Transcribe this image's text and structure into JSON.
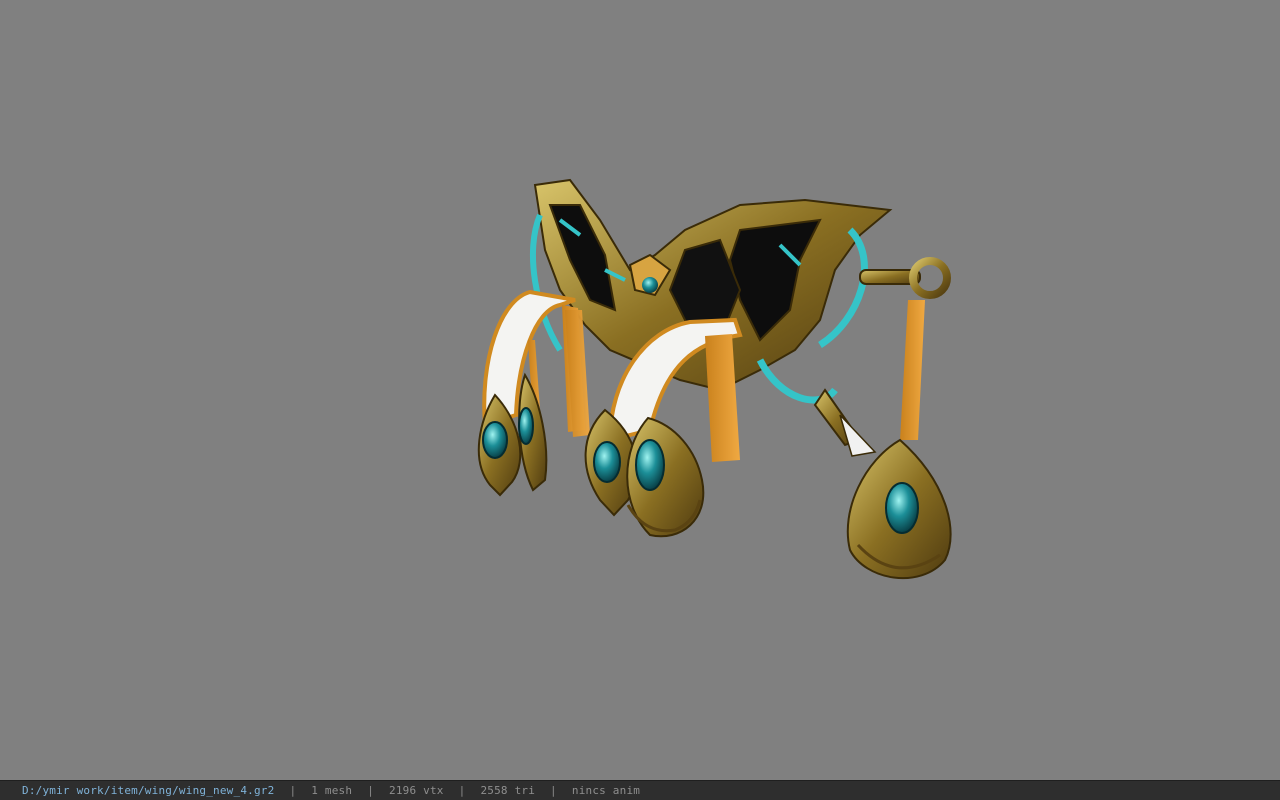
{
  "viewport": {
    "background_color": "#808080",
    "model_icon": "ornate-wing-model"
  },
  "statusbar": {
    "file_path": "D:/ymir work/item/wing/wing_new_4.gr2",
    "separator": "|",
    "mesh_count": "1 mesh",
    "vertex_count": "2196 vtx",
    "triangle_count": "2558 tri",
    "animation_status": "nincs anim",
    "path_color": "#7fb2d8",
    "text_color": "#8f8f8f"
  }
}
